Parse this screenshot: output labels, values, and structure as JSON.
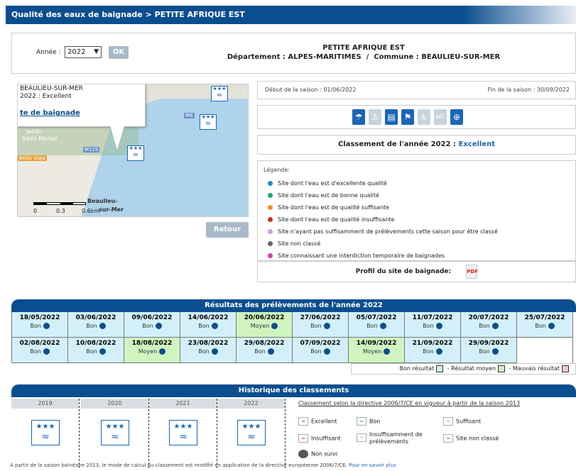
{
  "title": "Qualité des eaux de baignade > PETITE AFRIQUE EST",
  "year_selector": {
    "label": "Année :",
    "value": "2022",
    "ok": "OK"
  },
  "site": {
    "name": "PETITE AFRIQUE EST",
    "departement_label": "Département :",
    "departement": "ALPES-MARITIMES",
    "separator": "/",
    "commune_label": "Commune :",
    "commune": "BEAULIEU-SUR-MER"
  },
  "map": {
    "popup_line1": "BEAULIEU-SUR-MER",
    "popup_line2": "2022 : Excellent",
    "popup_link": "te de baignade",
    "labels": [
      "Jardin",
      "Saint-Michel",
      "Beaulieu-",
      "sur-Mer"
    ],
    "road_labels": [
      "M6",
      "M125",
      "Bella Vista"
    ],
    "scale_labels": [
      "0",
      "0.3",
      "0.6km"
    ]
  },
  "retour": "Retour",
  "season": {
    "start_label": "Début de la saison :",
    "start": "01/06/2022",
    "end_label": "Fin de la saison :",
    "end": "30/09/2022"
  },
  "service_icons": [
    "umbrella-icon",
    "lifeguard-icon",
    "shower-icon",
    "toilet-icon",
    "accessibility-icon",
    "wc-icon",
    "first-aid-icon"
  ],
  "classement": {
    "label": "Classement de l'année 2022 :",
    "value": "Excellent"
  },
  "legend": {
    "title": "Légende:",
    "items": [
      {
        "text": "Site dont l'eau est d'excellente qualité",
        "color": "#1a8fd0"
      },
      {
        "text": "Site dont l'eau est de bonne qualité",
        "color": "#1aa871"
      },
      {
        "text": "Site dont l'eau est de qualité suffisante",
        "color": "#f0921c"
      },
      {
        "text": "Site dont l'eau est de qualité insuffisante",
        "color": "#c8321e"
      },
      {
        "text": "Site n'ayant pas suffisamment de prélèvements cette saison pour être classé",
        "color": "#c9a0d8"
      },
      {
        "text": "Site non classé",
        "color": "#666666"
      },
      {
        "text": "Site connaissant une interdiction temporaire de baignades",
        "color": "#d63aa8"
      }
    ]
  },
  "profil": "Profil du site de baignade:",
  "pdf_label": "PDF",
  "results": {
    "title": "Résultats des prélèvements de l'année 2022",
    "rows": [
      [
        {
          "date": "18/05/2022",
          "status": "Bon"
        },
        {
          "date": "03/06/2022",
          "status": "Bon"
        },
        {
          "date": "09/06/2022",
          "status": "Bon"
        },
        {
          "date": "14/06/2022",
          "status": "Bon"
        },
        {
          "date": "20/06/2022",
          "status": "Moyen"
        },
        {
          "date": "27/06/2022",
          "status": "Bon"
        },
        {
          "date": "05/07/2022",
          "status": "Bon"
        },
        {
          "date": "11/07/2022",
          "status": "Bon"
        },
        {
          "date": "20/07/2022",
          "status": "Bon"
        },
        {
          "date": "25/07/2022",
          "status": "Bon"
        }
      ],
      [
        {
          "date": "02/08/2022",
          "status": "Bon"
        },
        {
          "date": "10/08/2022",
          "status": "Bon"
        },
        {
          "date": "18/08/2022",
          "status": "Moyen"
        },
        {
          "date": "23/08/2022",
          "status": "Bon"
        },
        {
          "date": "29/08/2022",
          "status": "Bon"
        },
        {
          "date": "07/09/2022",
          "status": "Bon"
        },
        {
          "date": "14/09/2022",
          "status": "Moyen"
        },
        {
          "date": "21/09/2022",
          "status": "Bon"
        },
        {
          "date": "29/09/2022",
          "status": "Bon"
        }
      ]
    ],
    "legend": {
      "bon": "Bon résultat",
      "moyen": "- Résultat moyen",
      "mauvais": "- Mauvais résultat"
    },
    "colors": {
      "bon": "#d3f0fa",
      "moyen": "#d0f4c0",
      "mauvais": "#f7c6c6"
    }
  },
  "history": {
    "title": "Historique des classements",
    "years": [
      "2019",
      "2020",
      "2021",
      "2022"
    ],
    "directive": "Classement selon la directive 2006/7/CE en vigueur à partir de la saison 2013",
    "legend": [
      "Excellent",
      "Bon",
      "Suffisant",
      "Insuffisant",
      "Insuffisamment de",
      "prélèvements",
      "Site non classé",
      "Non suivi"
    ]
  },
  "footnote": {
    "text": "A partir de la saison balnéaire 2013, le mode de calcul du classement est modifié en application de la directive européenne 2006/7/CE.",
    "link": "Pour en savoir plus"
  }
}
